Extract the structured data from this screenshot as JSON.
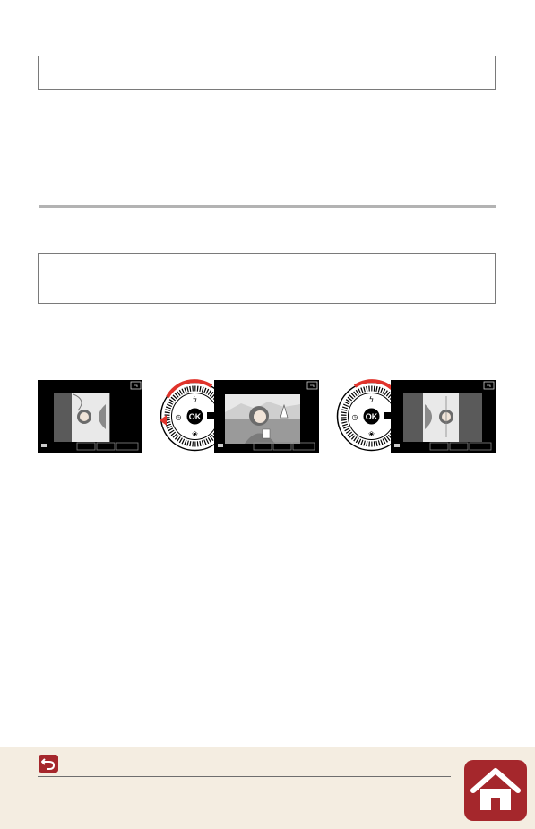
{
  "top_box": {
    "text": ""
  },
  "note_box": {
    "text": ""
  },
  "figure": {
    "screens": [
      {
        "orientation": "rotated-left",
        "icon": "back-icon"
      },
      {
        "orientation": "normal",
        "icon": "back-icon"
      },
      {
        "orientation": "rotated-right",
        "icon": "back-icon"
      }
    ],
    "dials": [
      {
        "label": "OK",
        "arrow_direction": "left",
        "accent": "#e0332b"
      },
      {
        "label": "OK",
        "arrow_direction": "right",
        "accent": "#e0332b"
      }
    ]
  },
  "footer": {
    "back_icon": "back-arrow-icon",
    "home_icon": "home-icon",
    "accent": "#a5272c",
    "background": "#f4ede1"
  }
}
